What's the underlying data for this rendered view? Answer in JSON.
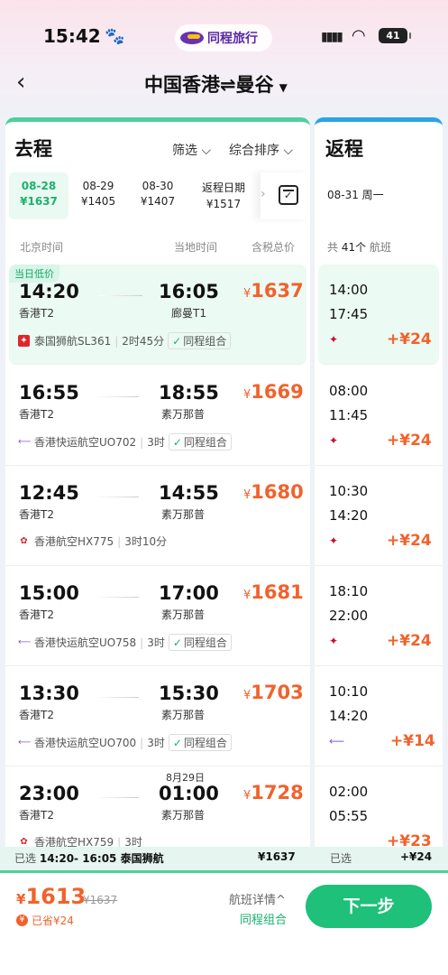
{
  "status": {
    "time": "15:42",
    "brand": "同程旅行",
    "battery": "41"
  },
  "nav": {
    "route": "中国香港⇌曼谷"
  },
  "outbound": {
    "title": "去程",
    "filter": "筛选",
    "sort": "综合排序",
    "dates": [
      {
        "date": "08-28",
        "price": "¥1637",
        "active": true
      },
      {
        "date": "08-29",
        "price": "¥1405"
      },
      {
        "date": "08-30",
        "price": "¥1407"
      },
      {
        "date": "返程日期",
        "price": "¥1517"
      }
    ],
    "columns": {
      "left": "北京时间",
      "mid": "当地时间",
      "right": "含税总价"
    },
    "flights": [
      {
        "tag": "当日低价",
        "dep": "14:20",
        "arr": "16:05",
        "dep_ap": "香港T2",
        "arr_ap": "廊曼T1",
        "price": "1637",
        "airline": "泰国狮航SL361",
        "duration": "2时45分",
        "combo": "同程组合",
        "icon": "lion-air-icon"
      },
      {
        "dep": "16:55",
        "arr": "18:55",
        "dep_ap": "香港T2",
        "arr_ap": "素万那普",
        "price": "1669",
        "airline": "香港快运航空UO702",
        "duration": "3时",
        "combo": "同程组合",
        "icon": "hk-express-icon"
      },
      {
        "dep": "12:45",
        "arr": "14:55",
        "dep_ap": "香港T2",
        "arr_ap": "素万那普",
        "price": "1680",
        "airline": "香港航空HX775",
        "duration": "3时10分",
        "icon": "hk-airlines-icon"
      },
      {
        "dep": "15:00",
        "arr": "17:00",
        "dep_ap": "香港T2",
        "arr_ap": "素万那普",
        "price": "1681",
        "airline": "香港快运航空UO758",
        "duration": "3时",
        "combo": "同程组合",
        "icon": "hk-express-icon"
      },
      {
        "dep": "13:30",
        "arr": "15:30",
        "dep_ap": "香港T2",
        "arr_ap": "素万那普",
        "price": "1703",
        "airline": "香港快运航空UO700",
        "duration": "3时",
        "combo": "同程组合",
        "icon": "hk-express-icon"
      },
      {
        "dep": "23:00",
        "arr": "01:00",
        "next_day": "8月29日",
        "dep_ap": "香港T2",
        "arr_ap": "素万那普",
        "price": "1728",
        "airline": "香港航空HX759",
        "duration": "3时",
        "icon": "hk-airlines-icon"
      }
    ]
  },
  "return": {
    "title": "返程",
    "date": "08-31 周一",
    "count_prefix": "共",
    "count": "41个",
    "count_suffix": "航班",
    "flights": [
      {
        "t1": "14:00",
        "t2": "17:45",
        "add": "+¥24"
      },
      {
        "t1": "08:00",
        "t2": "11:45",
        "add": "+¥24"
      },
      {
        "t1": "10:30",
        "t2": "14:20",
        "add": "+¥24"
      },
      {
        "t1": "18:10",
        "t2": "22:00",
        "add": "+¥24"
      },
      {
        "t1": "10:10",
        "t2": "14:20",
        "add": "+¥14"
      },
      {
        "t1": "02:00",
        "t2": "05:55",
        "add": "+¥23"
      }
    ]
  },
  "selected": {
    "label": "已选",
    "out_info": "14:20- 16:05 泰国狮航",
    "out_price": "¥1637",
    "ret_label": "已选",
    "ret_price": "+¥24"
  },
  "bottom": {
    "price": "1613",
    "orig": "¥1637",
    "saved": "已省¥24",
    "detail": "航班详情^",
    "combo": "同程组合",
    "next": "下一步"
  },
  "colors": {
    "accent": "#1ec07a",
    "price": "#f1622c",
    "return_accent": "#2aa3e8"
  }
}
